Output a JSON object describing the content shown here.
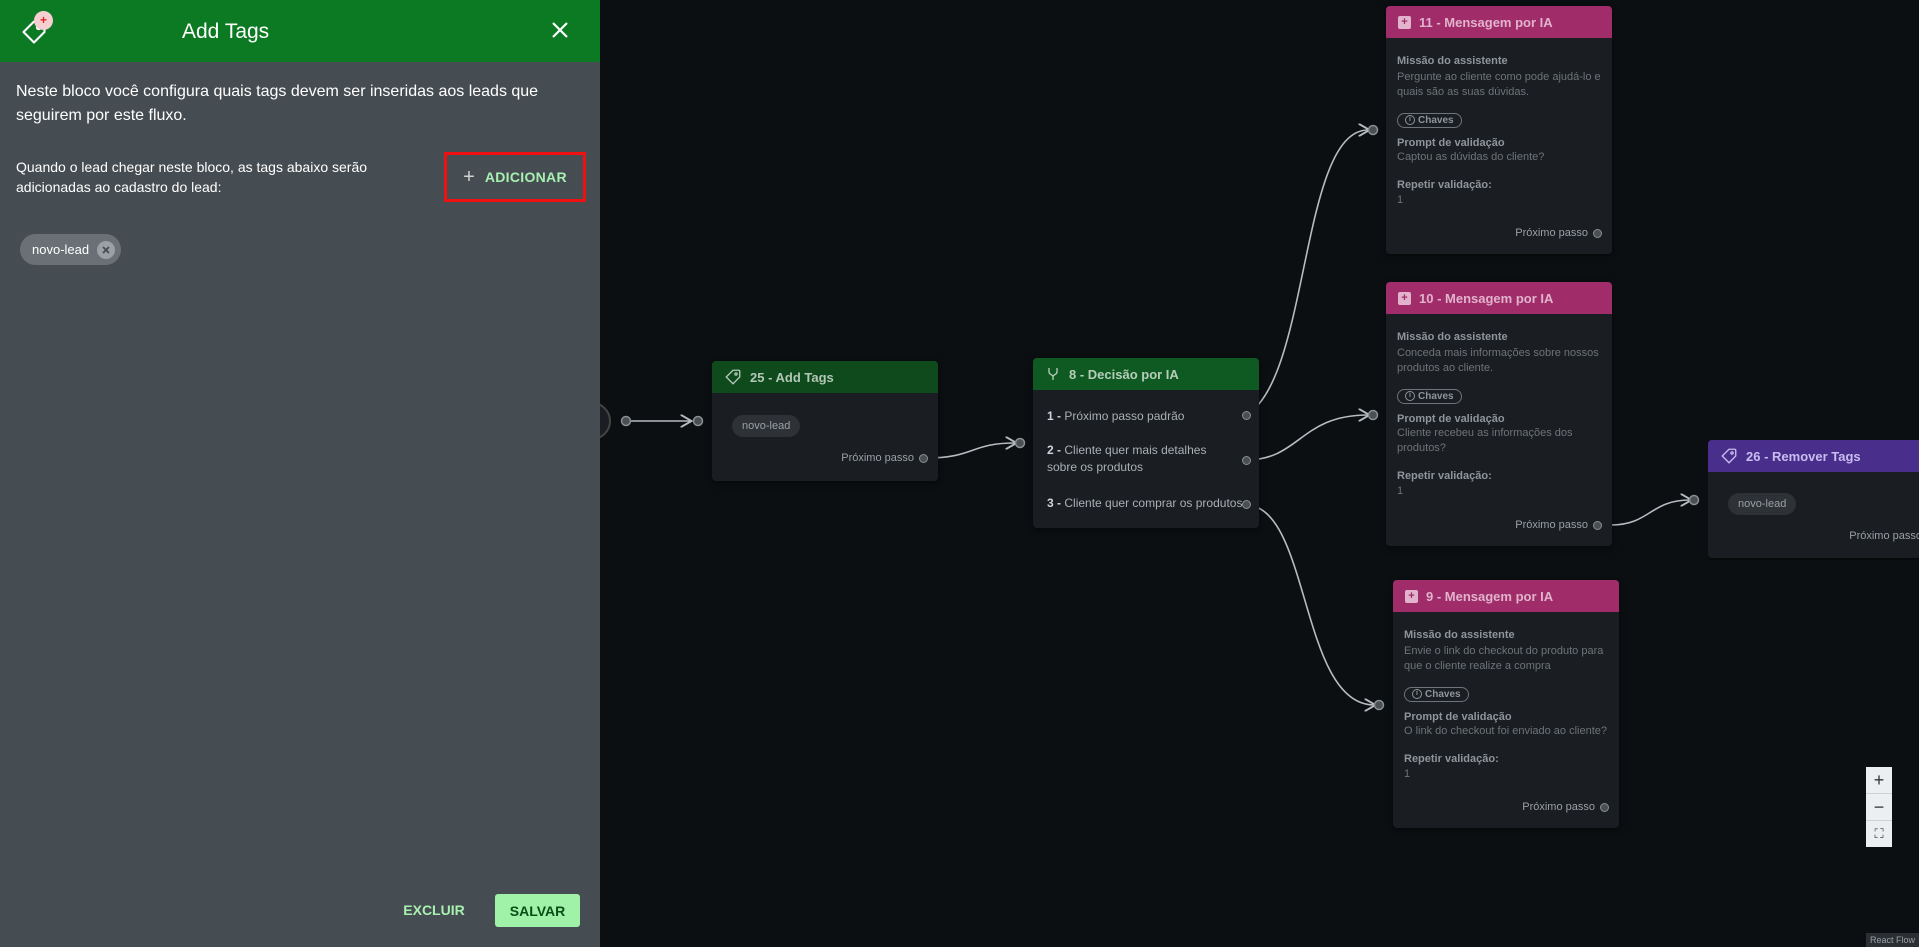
{
  "panel": {
    "title": "Add Tags",
    "badge": "+",
    "intro": "Neste bloco você configura quais tags devem ser inseridas aos leads que seguirem por este fluxo.",
    "rule_text": "Quando o lead chegar neste bloco, as tags abaixo serão adicionadas ao cadastro do lead:",
    "add_label": "ADICIONAR",
    "tags": [
      "novo-lead"
    ],
    "delete_label": "EXCLUIR",
    "save_label": "SALVAR"
  },
  "nodes": {
    "add_tags": {
      "title": "25 - Add Tags",
      "tag": "novo-lead",
      "next_step": "Próximo passo"
    },
    "decision": {
      "title": "8 - Decisão por IA",
      "options": [
        {
          "num": "1 -",
          "text": "Próximo passo padrão"
        },
        {
          "num": "2 -",
          "text": "Cliente quer mais detalhes sobre os produtos"
        },
        {
          "num": "3 -",
          "text": "Cliente quer comprar os produtos"
        }
      ]
    },
    "msg11": {
      "title": "11 - Mensagem por IA",
      "mission_label": "Missão do assistente",
      "mission": "Pergunte ao cliente como pode ajudá-lo e quais são as suas dúvidas.",
      "keys_label": "Chaves",
      "prompt_label": "Prompt de validação",
      "prompt": "Captou as dúvidas do cliente?",
      "repeat_label": "Repetir validação:",
      "repeat": "1",
      "next_step": "Próximo passo"
    },
    "msg10": {
      "title": "10 - Mensagem por IA",
      "mission_label": "Missão do assistente",
      "mission": "Conceda mais informações sobre nossos produtos ao cliente.",
      "keys_label": "Chaves",
      "prompt_label": "Prompt de validação",
      "prompt": "Cliente recebeu as informações dos produtos?",
      "repeat_label": "Repetir validação:",
      "repeat": "1",
      "next_step": "Próximo passo"
    },
    "msg9": {
      "title": "9 - Mensagem por IA",
      "mission_label": "Missão do assistente",
      "mission": "Envie o link do checkout do produto para que o cliente realize a compra",
      "keys_label": "Chaves",
      "prompt_label": "Prompt de validação",
      "prompt": "O link do checkout foi enviado ao cliente?",
      "repeat_label": "Repetir validação:",
      "repeat": "1",
      "next_step": "Próximo passo"
    },
    "remove_tags": {
      "title": "26 - Remover Tags",
      "tag": "novo-lead",
      "next_step": "Próximo passo"
    }
  },
  "zoom": {
    "in": "+",
    "out": "−",
    "fit": "⛶"
  },
  "attribution": "React Flow",
  "colors": {
    "header_green": "#0c7a22",
    "accent_green": "#a8f0b0",
    "pink": "#a02d6a",
    "purple": "#4a2e8c",
    "highlight_red": "#ee1111"
  }
}
